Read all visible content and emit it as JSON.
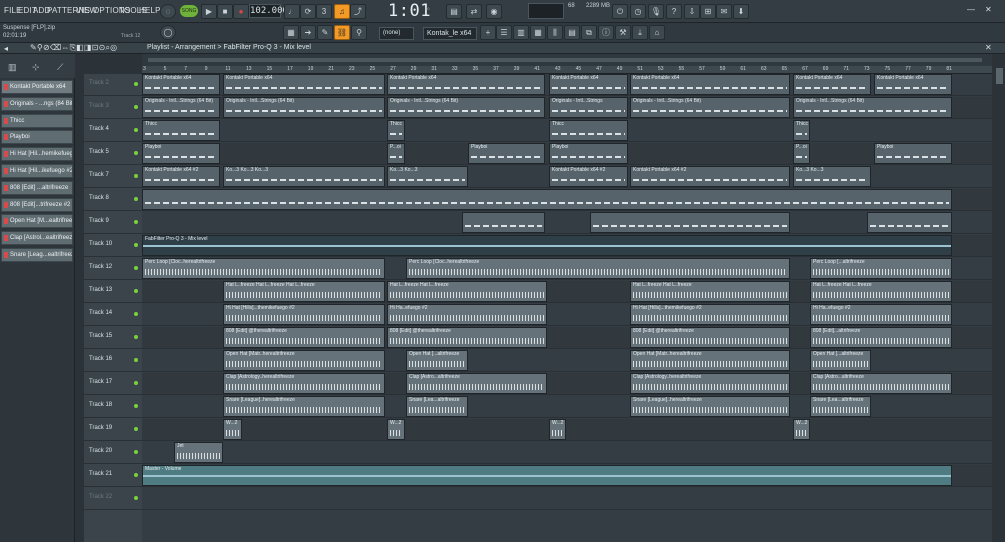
{
  "menu": [
    "FILE",
    "EDIT",
    "ADD",
    "PATTERNS",
    "VIEW",
    "OPTIONS",
    "TOOLS",
    "HELP"
  ],
  "transport": {
    "song_mode": "SONG",
    "tempo": "102.000",
    "time": "1:01",
    "time_sub": "00"
  },
  "cpu": "68",
  "memory": "2289 MB",
  "project": {
    "name": "Suspense [FLP].zip",
    "time": "02:01:19",
    "hint_track": "Track 12"
  },
  "toolbar": {
    "pattern_select": "(none)",
    "channel_select": "Kontak_le x64"
  },
  "playlist": {
    "title": "Playlist - Arrangement > FabFilter Pro-Q 3 - Mix level"
  },
  "picker": {
    "items": [
      "Kontakt Portable x64",
      "Originals - ...ngs (84 Bit)",
      "Thicc",
      "Playboi",
      "Hi Hat [Hil...hemikefuego",
      "Hi Hat [Hil...ikefuego #2",
      "808 [Edit] ...altrifreeze",
      "808 [Edit]...trifreeze #2",
      "Open Hat [M...ealtrifreeze",
      "Clap [Astrol...ealtrifreeze",
      "Snare [Leag...ealtrifreeze"
    ]
  },
  "ruler": {
    "bars": [
      "3",
      "5",
      "7",
      "9",
      "11",
      "13",
      "15",
      "17",
      "19",
      "21",
      "23",
      "25",
      "27",
      "29",
      "31",
      "33",
      "35",
      "37",
      "39",
      "41",
      "43",
      "45",
      "47",
      "49",
      "51",
      "53",
      "55",
      "57",
      "59",
      "61",
      "63",
      "65",
      "67",
      "69",
      "71",
      "73",
      "75",
      "77",
      "79",
      "81"
    ]
  },
  "tracks": [
    {
      "name": "Track 2",
      "dim": true
    },
    {
      "name": "Track 3",
      "dim": true
    },
    {
      "name": "Track 4",
      "dim": false
    },
    {
      "name": "Track 5",
      "dim": false
    },
    {
      "name": "Track 7",
      "dim": false
    },
    {
      "name": "Track 8",
      "dim": false
    },
    {
      "name": "Track 9",
      "dim": false
    },
    {
      "name": "Track 10",
      "dim": false
    },
    {
      "name": "Track 12",
      "dim": false
    },
    {
      "name": "Track 13",
      "dim": false
    },
    {
      "name": "Track 14",
      "dim": false
    },
    {
      "name": "Track 15",
      "dim": false
    },
    {
      "name": "Track 16",
      "dim": false
    },
    {
      "name": "Track 17",
      "dim": false
    },
    {
      "name": "Track 18",
      "dim": false
    },
    {
      "name": "Track 19",
      "dim": false
    },
    {
      "name": "Track 20",
      "dim": false
    },
    {
      "name": "Track 21",
      "dim": false
    },
    {
      "name": "Track 22",
      "dim": true
    }
  ],
  "clips": [
    {
      "lane": 0,
      "start": 0,
      "end": 78,
      "label": "Kontakt Portable x64",
      "kind": "notes"
    },
    {
      "lane": 0,
      "start": 81,
      "end": 243,
      "label": "Kontakt Portable x64",
      "kind": "notes"
    },
    {
      "lane": 0,
      "start": 245,
      "end": 403,
      "label": "Kontakt Portable x64",
      "kind": "notes"
    },
    {
      "lane": 0,
      "start": 407,
      "end": 486,
      "label": "Kontakt Portable x64",
      "kind": "notes"
    },
    {
      "lane": 0,
      "start": 488,
      "end": 648,
      "label": "Kontakt Portable x64",
      "kind": "notes"
    },
    {
      "lane": 0,
      "start": 651,
      "end": 729,
      "label": "Kontakt Portable x64",
      "kind": "notes"
    },
    {
      "lane": 0,
      "start": 732,
      "end": 810,
      "label": "Kontakt Portable x64",
      "kind": "notes"
    },
    {
      "lane": 1,
      "start": 0,
      "end": 78,
      "label": "Originals - Intl...Strings (64 Bit)",
      "kind": "notes"
    },
    {
      "lane": 1,
      "start": 81,
      "end": 243,
      "label": "Originals - Intl...Strings (64 Bit)",
      "kind": "notes"
    },
    {
      "lane": 1,
      "start": 245,
      "end": 403,
      "label": "Originals - Intl...Strings (64 Bit)",
      "kind": "notes"
    },
    {
      "lane": 1,
      "start": 407,
      "end": 486,
      "label": "Originals - Intl...Strings",
      "kind": "notes"
    },
    {
      "lane": 1,
      "start": 488,
      "end": 648,
      "label": "Originals - Intl...Strings (64 Bit)",
      "kind": "notes"
    },
    {
      "lane": 1,
      "start": 651,
      "end": 810,
      "label": "Originals - Intl...Strings (64 Bit)",
      "kind": "notes"
    },
    {
      "lane": 2,
      "start": 0,
      "end": 78,
      "label": "Thicc",
      "kind": "notes"
    },
    {
      "lane": 2,
      "start": 245,
      "end": 263,
      "label": "Thicc",
      "kind": "notes"
    },
    {
      "lane": 2,
      "start": 407,
      "end": 486,
      "label": "Thicc",
      "kind": "notes"
    },
    {
      "lane": 2,
      "start": 651,
      "end": 668,
      "label": "Thicc",
      "kind": "notes"
    },
    {
      "lane": 3,
      "start": 0,
      "end": 78,
      "label": "Playboi",
      "kind": "notes"
    },
    {
      "lane": 3,
      "start": 245,
      "end": 263,
      "label": "P...oi",
      "kind": "notes"
    },
    {
      "lane": 3,
      "start": 326,
      "end": 403,
      "label": "Playboi",
      "kind": "notes"
    },
    {
      "lane": 3,
      "start": 407,
      "end": 486,
      "label": "Playboi",
      "kind": "notes"
    },
    {
      "lane": 3,
      "start": 651,
      "end": 668,
      "label": "P...oi",
      "kind": "notes"
    },
    {
      "lane": 3,
      "start": 732,
      "end": 810,
      "label": "Playboi",
      "kind": "notes"
    },
    {
      "lane": 4,
      "start": 0,
      "end": 78,
      "label": "Kontakt Portable x64 #2",
      "kind": "notes"
    },
    {
      "lane": 4,
      "start": 81,
      "end": 243,
      "label": "Ko...3  Ko...3  Ko...3",
      "kind": "notes"
    },
    {
      "lane": 4,
      "start": 245,
      "end": 326,
      "label": "Ko...3  Ko...3",
      "kind": "notes"
    },
    {
      "lane": 4,
      "start": 407,
      "end": 486,
      "label": "Kontakt Portable x64 #2",
      "kind": "notes"
    },
    {
      "lane": 4,
      "start": 488,
      "end": 648,
      "label": "Kontakt Portable x64 #2",
      "kind": "notes"
    },
    {
      "lane": 4,
      "start": 651,
      "end": 729,
      "label": "Ko...3  Ko...3",
      "kind": "notes"
    },
    {
      "lane": 5,
      "start": 0,
      "end": 810,
      "label": "",
      "kind": "notes"
    },
    {
      "lane": 6,
      "start": 320,
      "end": 403,
      "label": "",
      "kind": "notes"
    },
    {
      "lane": 6,
      "start": 448,
      "end": 648,
      "label": "",
      "kind": "notes"
    },
    {
      "lane": 6,
      "start": 725,
      "end": 810,
      "label": "",
      "kind": "notes"
    },
    {
      "lane": 7,
      "start": 0,
      "end": 810,
      "label": "FabFilter Pro-Q 3 - Mix level",
      "kind": "auto"
    },
    {
      "lane": 8,
      "start": 0,
      "end": 243,
      "label": "Perc Loop [Cloc..herealtrifreeze",
      "kind": "audio"
    },
    {
      "lane": 8,
      "start": 264,
      "end": 648,
      "label": "Perc Loop [Cloc..herealtrifreeze",
      "kind": "audio"
    },
    {
      "lane": 8,
      "start": 668,
      "end": 810,
      "label": "Perc Loop [...altrifreeze",
      "kind": "audio"
    },
    {
      "lane": 9,
      "start": 81,
      "end": 243,
      "label": "Hat L..freeze  Hat L..freeze  Hat L..freeze",
      "kind": "audio"
    },
    {
      "lane": 9,
      "start": 245,
      "end": 405,
      "label": "Hat L..freeze  Hat L..freeze",
      "kind": "audio"
    },
    {
      "lane": 9,
      "start": 488,
      "end": 648,
      "label": "Hat L..freeze  Hat L..freeze",
      "kind": "audio"
    },
    {
      "lane": 9,
      "start": 668,
      "end": 810,
      "label": "Hat L..freeze  Hat L..freeze",
      "kind": "audio"
    },
    {
      "lane": 10,
      "start": 81,
      "end": 243,
      "label": "Hi Hat [Hills]...themikefuego #2",
      "kind": "audio"
    },
    {
      "lane": 10,
      "start": 245,
      "end": 405,
      "label": "Hi Ha..efuego #2",
      "kind": "audio"
    },
    {
      "lane": 10,
      "start": 488,
      "end": 648,
      "label": "Hi Hat [Hills]...themikefuego #2",
      "kind": "audio"
    },
    {
      "lane": 10,
      "start": 668,
      "end": 810,
      "label": "Hi Ha..efuego #2",
      "kind": "audio"
    },
    {
      "lane": 11,
      "start": 81,
      "end": 243,
      "label": "808 [Edit] @therealtrifreeze",
      "kind": "audio"
    },
    {
      "lane": 11,
      "start": 245,
      "end": 405,
      "label": "808 [Edit] @therealtrifreeze",
      "kind": "audio"
    },
    {
      "lane": 11,
      "start": 488,
      "end": 648,
      "label": "808 [Edit] @therealtrifreeze",
      "kind": "audio"
    },
    {
      "lane": 11,
      "start": 668,
      "end": 810,
      "label": "808 [Edit]...altrifreeze",
      "kind": "audio"
    },
    {
      "lane": 12,
      "start": 81,
      "end": 243,
      "label": "Open Hat [Matr..herealtrifreeze",
      "kind": "audio"
    },
    {
      "lane": 12,
      "start": 264,
      "end": 326,
      "label": "Open Hat [...altrifreeze",
      "kind": "audio"
    },
    {
      "lane": 12,
      "start": 488,
      "end": 648,
      "label": "Open Hat [Matr..herealtrifreeze",
      "kind": "audio"
    },
    {
      "lane": 12,
      "start": 668,
      "end": 729,
      "label": "Open Hat [...altrifreeze",
      "kind": "audio"
    },
    {
      "lane": 13,
      "start": 81,
      "end": 243,
      "label": "Clap [Astrology..herealtrifreeze",
      "kind": "audio"
    },
    {
      "lane": 13,
      "start": 264,
      "end": 405,
      "label": "Clap [Astro...altrifreeze",
      "kind": "audio"
    },
    {
      "lane": 13,
      "start": 488,
      "end": 648,
      "label": "Clap [Astrology..herealtrifreeze",
      "kind": "audio"
    },
    {
      "lane": 13,
      "start": 668,
      "end": 810,
      "label": "Clap [Astro...altrifreeze",
      "kind": "audio"
    },
    {
      "lane": 14,
      "start": 81,
      "end": 243,
      "label": "Snare [League]..herealtrifreeze",
      "kind": "audio"
    },
    {
      "lane": 14,
      "start": 264,
      "end": 326,
      "label": "Snare [Lea...altrifreeze",
      "kind": "audio"
    },
    {
      "lane": 14,
      "start": 488,
      "end": 648,
      "label": "Snare [League]..herealtrifreeze",
      "kind": "audio"
    },
    {
      "lane": 14,
      "start": 668,
      "end": 729,
      "label": "Snare [Lea...altrifreeze",
      "kind": "audio"
    },
    {
      "lane": 15,
      "start": 81,
      "end": 100,
      "label": "W...2",
      "kind": "audio"
    },
    {
      "lane": 15,
      "start": 245,
      "end": 263,
      "label": "W...2",
      "kind": "audio"
    },
    {
      "lane": 15,
      "start": 407,
      "end": 424,
      "label": "W...2",
      "kind": "audio"
    },
    {
      "lane": 15,
      "start": 651,
      "end": 668,
      "label": "W...2",
      "kind": "audio"
    },
    {
      "lane": 16,
      "start": 32,
      "end": 81,
      "label": "Jet",
      "kind": "audio"
    },
    {
      "lane": 17,
      "start": 0,
      "end": 810,
      "label": "Master - Volume",
      "kind": "master"
    }
  ]
}
